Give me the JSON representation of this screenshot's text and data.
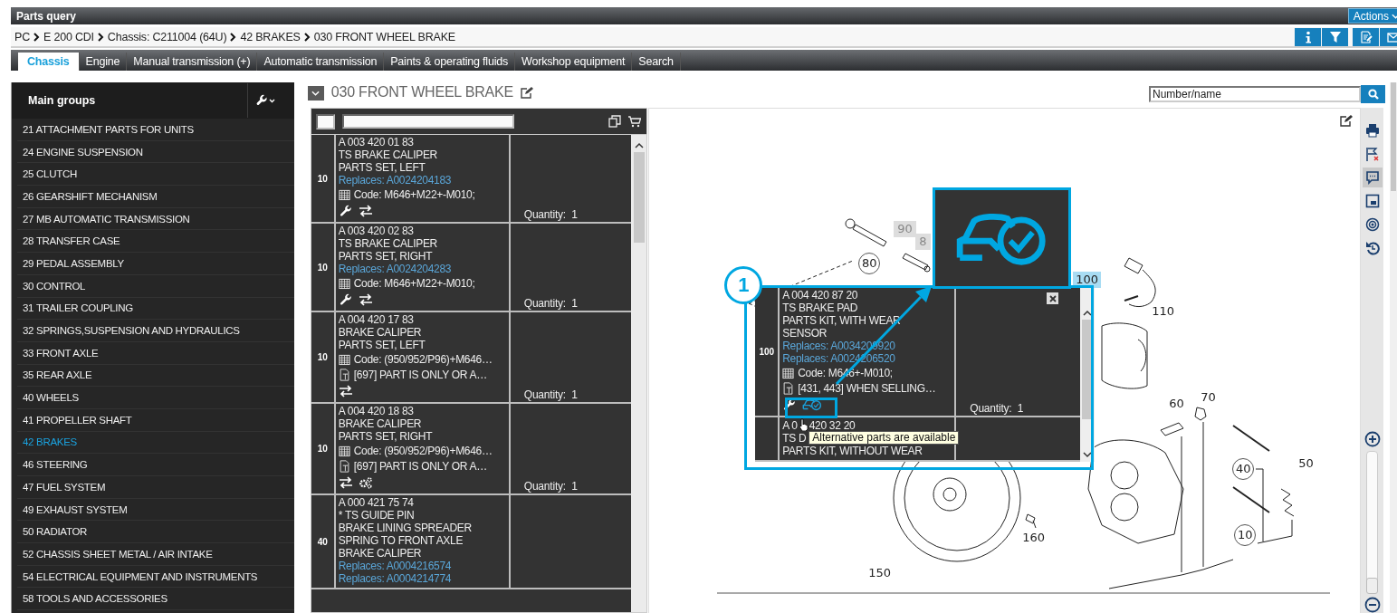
{
  "window": {
    "title": "Parts query",
    "actions_button": "Actions"
  },
  "breadcrumb": [
    {
      "label": "PC"
    },
    {
      "label": "E 200 CDI"
    },
    {
      "label": "Chassis: C211004 (64U)"
    },
    {
      "label": "42 BRAKES"
    },
    {
      "label": "030 FRONT WHEEL BRAKE"
    }
  ],
  "header_buttons": [
    {
      "kind": "info"
    },
    {
      "kind": "filter"
    },
    {
      "kind": "export"
    },
    {
      "kind": "mail"
    }
  ],
  "tabs": [
    {
      "label": "Chassis",
      "selected": true
    },
    {
      "label": "Engine",
      "selected": false
    },
    {
      "label": "Manual transmission (+)",
      "selected": false
    },
    {
      "label": "Automatic transmission",
      "selected": false
    },
    {
      "label": "Paints & operating fluids",
      "selected": false
    },
    {
      "label": "Workshop equipment",
      "selected": false
    },
    {
      "label": "Search",
      "selected": false
    }
  ],
  "sidebar": {
    "title": "Main groups",
    "items": [
      {
        "label": "21 ATTACHMENT PARTS FOR UNITS",
        "selected": false
      },
      {
        "label": "24 ENGINE SUSPENSION",
        "selected": false
      },
      {
        "label": "25 CLUTCH",
        "selected": false
      },
      {
        "label": "26 GEARSHIFT MECHANISM",
        "selected": false
      },
      {
        "label": "27 MB AUTOMATIC TRANSMISSION",
        "selected": false
      },
      {
        "label": "28 TRANSFER CASE",
        "selected": false
      },
      {
        "label": "29 PEDAL ASSEMBLY",
        "selected": false
      },
      {
        "label": "30 CONTROL",
        "selected": false
      },
      {
        "label": "31 TRAILER COUPLING",
        "selected": false
      },
      {
        "label": "32 SPRINGS,SUSPENSION AND HYDRAULICS",
        "selected": false
      },
      {
        "label": "33 FRONT AXLE",
        "selected": false
      },
      {
        "label": "35 REAR AXLE",
        "selected": false
      },
      {
        "label": "40 WHEELS",
        "selected": false
      },
      {
        "label": "41 PROPELLER SHAFT",
        "selected": false
      },
      {
        "label": "42 BRAKES",
        "selected": true
      },
      {
        "label": "46 STEERING",
        "selected": false
      },
      {
        "label": "47 FUEL SYSTEM",
        "selected": false
      },
      {
        "label": "49 EXHAUST SYSTEM",
        "selected": false
      },
      {
        "label": "50 RADIATOR",
        "selected": false
      },
      {
        "label": "52 CHASSIS SHEET METAL / AIR INTAKE",
        "selected": false
      },
      {
        "label": "54 ELECTRICAL EQUIPMENT AND INSTRUMENTS",
        "selected": false
      },
      {
        "label": "58 TOOLS AND ACCESSORIES",
        "selected": false
      }
    ]
  },
  "group": {
    "title": "030 FRONT WHEEL BRAKE"
  },
  "search": {
    "placeholder": "Number/name"
  },
  "select_all": {
    "checked": false
  },
  "parts": [
    {
      "callout": "10",
      "number": "A 003 420 01 83",
      "lines": [
        "TS BRAKE CALIPER",
        "PARTS SET, LEFT"
      ],
      "replaces": [
        "Replaces: A0024204183"
      ],
      "code": "Code: M646+M22+-M010;",
      "icons": [
        {
          "kind": "wrench"
        },
        {
          "kind": "swap"
        }
      ],
      "quantity": "Quantity:  1"
    },
    {
      "callout": "10",
      "number": "A 003 420 02 83",
      "lines": [
        "TS BRAKE CALIPER",
        "PARTS SET, RIGHT"
      ],
      "replaces": [
        "Replaces: A0024204283"
      ],
      "code": "Code: M646+M22+-M010;",
      "icons": [
        {
          "kind": "wrench"
        },
        {
          "kind": "swap"
        }
      ],
      "quantity": "Quantity:  1"
    },
    {
      "callout": "10",
      "number": "A 004 420 17 83",
      "lines": [
        "BRAKE CALIPER",
        "PARTS SET, LEFT"
      ],
      "code": "Code: (950/952/P96)+M646…",
      "note": "[697] PART IS ONLY OR A…",
      "icons": [
        {
          "kind": "swap"
        }
      ],
      "quantity": "Quantity:  1"
    },
    {
      "callout": "10",
      "number": "A 004 420 18 83",
      "lines": [
        "BRAKE CALIPER",
        "PARTS SET, RIGHT"
      ],
      "code": "Code: (950/952/P96)+M646…",
      "note": "[697] PART IS ONLY OR A…",
      "icons": [
        {
          "kind": "swap"
        },
        {
          "kind": "gears"
        }
      ],
      "quantity": "Quantity:  1"
    },
    {
      "callout": "40",
      "number": "A 000 421 75 74",
      "lines": [
        "* TS GUIDE PIN",
        "BRAKE LINING SPREADER",
        "SPRING TO FRONT AXLE",
        "BRAKE CALIPER"
      ],
      "replaces": [
        "Replaces: A0004216574",
        "Replaces: A0004214774"
      ]
    }
  ],
  "drawing": {
    "callouts": [
      {
        "label": "90",
        "kind": "box"
      },
      {
        "label": "8",
        "kind": "box"
      },
      {
        "label": "80",
        "kind": "circle"
      },
      {
        "label": "100",
        "kind": "highlight"
      },
      {
        "label": "110",
        "kind": "plain"
      },
      {
        "label": "60",
        "kind": "plain"
      },
      {
        "label": "70",
        "kind": "plain"
      },
      {
        "label": "40",
        "kind": "circle"
      },
      {
        "label": "50",
        "kind": "plain"
      },
      {
        "label": "10",
        "kind": "circle"
      },
      {
        "label": "160",
        "kind": "plain"
      },
      {
        "label": "150",
        "kind": "plain"
      }
    ]
  },
  "popup": {
    "parts": [
      {
        "callout": "100",
        "number": "A 004 420 87 20",
        "lines": [
          "TS BRAKE PAD",
          "PARTS KIT, WITH WEAR",
          "SENSOR"
        ],
        "replaces": [
          "Replaces: A0034209920",
          "Replaces: A0024206520"
        ],
        "code": "Code: M646+-M010;",
        "note": "[431, 443] WHEN SELLING…",
        "icons": [
          {
            "kind": "wrench"
          },
          {
            "kind": "alternative"
          }
        ],
        "quantity": "Quantity:  1"
      },
      {
        "number": "A 0",
        "number_rest": "420 32 20",
        "lines": [
          "TS D",
          "PARTS KIT, WITHOUT WEAR"
        ]
      }
    ]
  },
  "tooltip": {
    "text": "Alternative parts are available"
  },
  "annotation": {
    "number": "1"
  },
  "side_tools": [
    {
      "kind": "print",
      "selected": false
    },
    {
      "kind": "flag",
      "selected": false
    },
    {
      "kind": "comment",
      "selected": true
    },
    {
      "kind": "window",
      "selected": false
    },
    {
      "kind": "target",
      "selected": false
    },
    {
      "kind": "undo",
      "selected": false
    }
  ],
  "zoom": {
    "level": 0
  }
}
